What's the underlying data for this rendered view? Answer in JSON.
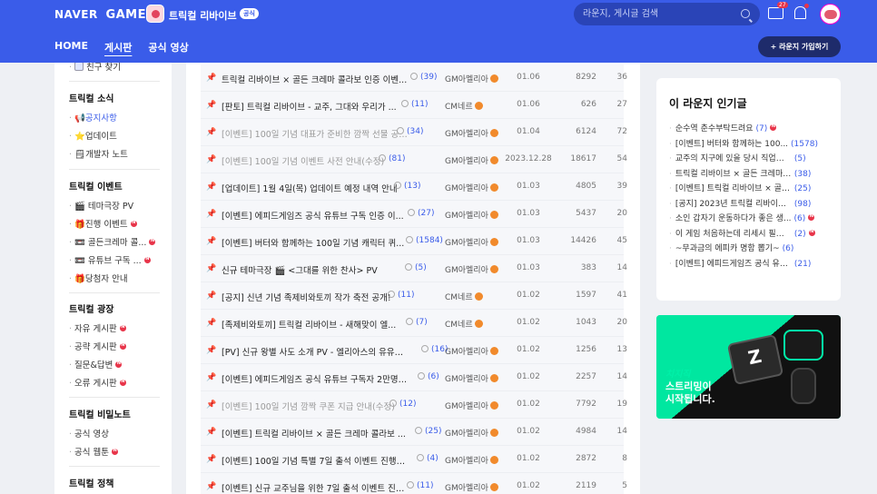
{
  "header": {
    "brand_naver": "NAVER",
    "brand_game": "GAME",
    "lounge_name": "트릭컬 리바이브",
    "official_badge": "공식",
    "search_placeholder": "라운지, 게시글 검색",
    "message_count": "27",
    "nav": [
      "HOME",
      "게시판",
      "공식 영상"
    ],
    "join_label": "+ 라운지 가입하기"
  },
  "sidebar": {
    "top_item": "친구 찾기",
    "sections": [
      {
        "title": "트릭컬 소식",
        "items": [
          "📢공지사항",
          "⭐업데이트",
          "🗒개발자 노트"
        ]
      },
      {
        "title": "트릭컬 이벤트",
        "items": [
          "🎬 테마극장 PV",
          "🎁진행 이벤트",
          "📼 골든크레마 콜...",
          "📼 유튜브 구독 ...",
          "🎁당첨자 안내"
        ]
      },
      {
        "title": "트릭컬 광장",
        "items": [
          "자유 게시판",
          "공략 게시판",
          "질문&답변",
          "오류 게시판"
        ]
      },
      {
        "title": "트릭컬 비밀노트",
        "items": [
          "공식 영상",
          "공식 웹툰"
        ]
      },
      {
        "title": "트릭컬 정책",
        "items": []
      }
    ]
  },
  "posts": [
    {
      "title": "트릭컬 리바이브 × 골든 크레마 콜라보 인증 이벤...",
      "comments": "(39)",
      "author": "GM아멜리아",
      "date": "01.06",
      "views": "8292",
      "likes": "36"
    },
    {
      "title": "[판토] 트릭컬 리바이브 - 교주, 그대와 우리가 ...",
      "comments": "(11)",
      "author": "CM네르",
      "date": "01.06",
      "views": "626",
      "likes": "27"
    },
    {
      "title": "[이벤트] 100일 기념 대표가 준비한 깜짝 선물 공개!",
      "comments": "(34)",
      "author": "GM아멜리아",
      "date": "01.04",
      "views": "6124",
      "likes": "72"
    },
    {
      "title": "[이벤트] 100일 기념 이벤트 사전 안내(수정)",
      "comments": "(81)",
      "author": "GM아멜리아",
      "date": "2023.12.28",
      "views": "18617",
      "likes": "54"
    },
    {
      "title": "[업데이트] 1월 4일(목) 업데이트 예정 내역 안내",
      "comments": "(13)",
      "author": "GM아멜리아",
      "date": "01.03",
      "views": "4805",
      "likes": "39"
    },
    {
      "title": "[이벤트] 에피드게임즈 공식 유튜브 구독 인증 이...",
      "comments": "(27)",
      "author": "GM아멜리아",
      "date": "01.03",
      "views": "5437",
      "likes": "20"
    },
    {
      "title": "[이벤트] 버터와 함께하는 100일 기념 캐릭터 퀴...",
      "comments": "(1584)",
      "author": "GM아멜리아",
      "date": "01.03",
      "views": "14426",
      "likes": "45"
    },
    {
      "title": "신규 테마극장 🎬 <그대를 위한 찬사> PV",
      "comments": "(5)",
      "author": "GM아멜리아",
      "date": "01.03",
      "views": "383",
      "likes": "14"
    },
    {
      "title": "[공지] 신년 기념 족제비와토끼 작가 축전 공개!",
      "comments": "(11)",
      "author": "CM네르",
      "date": "01.02",
      "views": "1597",
      "likes": "41"
    },
    {
      "title": "[족제비와토끼] 트릭컬 리바이브 - 새해맞이 엘...",
      "comments": "(7)",
      "author": "CM네르",
      "date": "01.02",
      "views": "1043",
      "likes": "20"
    },
    {
      "title": "[PV] 신규 왕별 사도 소개 PV - 엘리아스의 유유시...",
      "comments": "(16)",
      "author": "GM아멜리아",
      "date": "01.02",
      "views": "1256",
      "likes": "13"
    },
    {
      "title": "[이벤트] 에피드게임즈 공식 유튜브 구독자 2만명 ...",
      "comments": "(6)",
      "author": "GM아멜리아",
      "date": "01.02",
      "views": "2257",
      "likes": "14"
    },
    {
      "title": "[이벤트] 100일 기념 깜짝 쿠폰 지급 안내(수정)",
      "comments": "(12)",
      "author": "GM아멜리아",
      "date": "01.02",
      "views": "7792",
      "likes": "19"
    },
    {
      "title": "[이벤트] 트릭컬 리바이브 × 골든 크레마 콜라보 ...",
      "comments": "(25)",
      "author": "GM아멜리아",
      "date": "01.02",
      "views": "4984",
      "likes": "14"
    },
    {
      "title": "[이벤트] 100일 기념 특별 7일 출석 이벤트 진행 예...",
      "comments": "(4)",
      "author": "GM아멜리아",
      "date": "01.02",
      "views": "2872",
      "likes": "8"
    },
    {
      "title": "[이벤트] 신규 교주님을 위한 7일 출석 이벤트 진행...",
      "comments": "(11)",
      "author": "GM아멜리아",
      "date": "01.02",
      "views": "2119",
      "likes": "5"
    }
  ],
  "popular": {
    "title": "이 라운지 인기글",
    "items": [
      {
        "title": "순수역 춘수부탁드려요",
        "count": "(7)"
      },
      {
        "title": "[이벤트] 버터와 함께하는 100...",
        "count": "(1578)"
      },
      {
        "title": "교주의 지구에 있을 당시 직업에 대...",
        "count": "(5)"
      },
      {
        "title": "트릭컬 리바이브 × 골든 크레마 콜...",
        "count": "(38)"
      },
      {
        "title": "[이벤트] 트릭컬 리바이브 × 골든 ...",
        "count": "(25)"
      },
      {
        "title": "[공지] 2023년 트릭컬 리바이브와 ...",
        "count": "(98)"
      },
      {
        "title": "소인 갑자기 운동하다가 좋은 생...",
        "count": "(6)"
      },
      {
        "title": "이 게임 처음하는데 리세시 필요 ...",
        "count": "(2)"
      },
      {
        "title": "~무과금의 에피카 명함 뽑기~",
        "count": "(6)"
      },
      {
        "title": "[이벤트] 에피드게임즈 공식 유튜...",
        "count": "(21)"
      }
    ]
  },
  "banner": {
    "logo": "치지직",
    "line1": "스트리밍이",
    "line2": "시작됩니다."
  }
}
